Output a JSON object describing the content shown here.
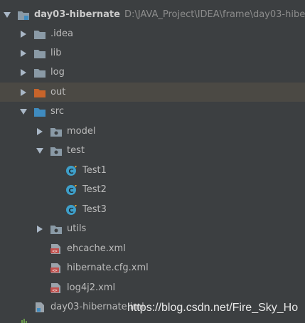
{
  "tree": {
    "root": {
      "name": "day03-hibernate",
      "path": "D:\\JAVA_Project\\IDEA\\frame\\day03-hibe"
    },
    "folders": [
      {
        "name": ".idea"
      },
      {
        "name": "lib"
      },
      {
        "name": "log"
      },
      {
        "name": "out"
      }
    ],
    "src": {
      "name": "src",
      "packages": {
        "model": "model",
        "test": "test",
        "utils": "utils"
      },
      "test_classes": [
        "Test1",
        "Test2",
        "Test3"
      ],
      "xml_files": [
        "ehcache.xml",
        "hibernate.cfg.xml",
        "log4j2.xml"
      ]
    },
    "iml_file": "day03-hibernate.iml"
  },
  "watermark": "https://blog.csdn.net/Fire_Sky_Ho",
  "colors": {
    "background": "#3c3f41",
    "selected_row": "#4b4944",
    "folder_gray": "#8a9aa6",
    "folder_out": "#c8642a",
    "folder_src": "#3f8bbf",
    "class_icon": "#3e9fc9",
    "xml_icon": "#c0504d"
  },
  "icons": {
    "root": "module-folder-icon",
    "folder": "folder-icon",
    "package": "package-icon",
    "class": "java-class-icon",
    "xml": "xml-file-icon",
    "iml": "iml-file-icon"
  }
}
